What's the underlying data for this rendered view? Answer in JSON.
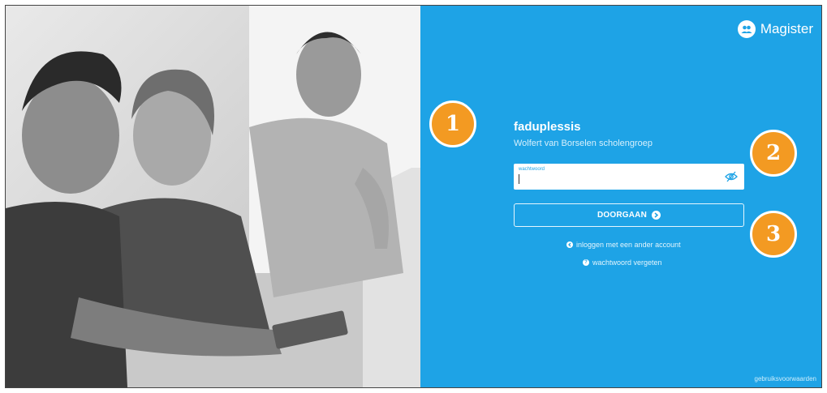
{
  "brand": {
    "name": "Magister"
  },
  "user": {
    "username": "faduplessis",
    "school": "Wolfert van Borselen scholengroep"
  },
  "password_field": {
    "label": "wachtwoord",
    "value": ""
  },
  "continue_button": {
    "label": "DOORGAAN"
  },
  "links": {
    "other_account": "inloggen met een ander account",
    "forgot_password": "wachtwoord vergeten"
  },
  "footer": {
    "terms": "gebruiksvoorwaarden"
  },
  "markers": [
    "1",
    "2",
    "3"
  ],
  "colors": {
    "panel": "#1ea3e6",
    "marker": "#f39a22"
  }
}
